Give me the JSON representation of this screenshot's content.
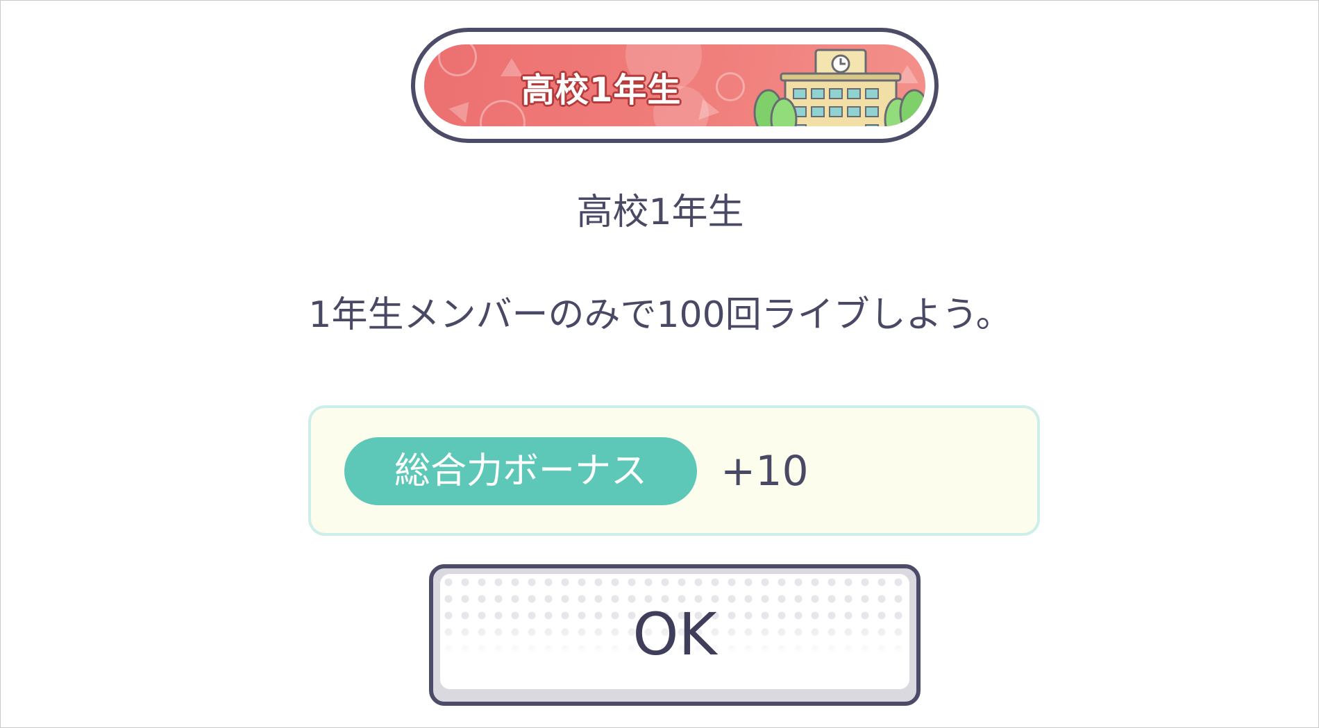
{
  "badge": {
    "label": "高校1年生",
    "icon": "school-building-icon"
  },
  "title": "高校1年生",
  "description": "1年生メンバーのみで100回ライブしよう。",
  "bonus": {
    "label": "総合力ボーナス",
    "value": "+10"
  },
  "ok_button": {
    "label": "OK"
  },
  "colors": {
    "badge_red": "#ec7070",
    "outline": "#4c4b68",
    "text": "#4a4965",
    "bonus_teal": "#5ec8b8",
    "bonus_box_bg": "#fdfdee"
  }
}
